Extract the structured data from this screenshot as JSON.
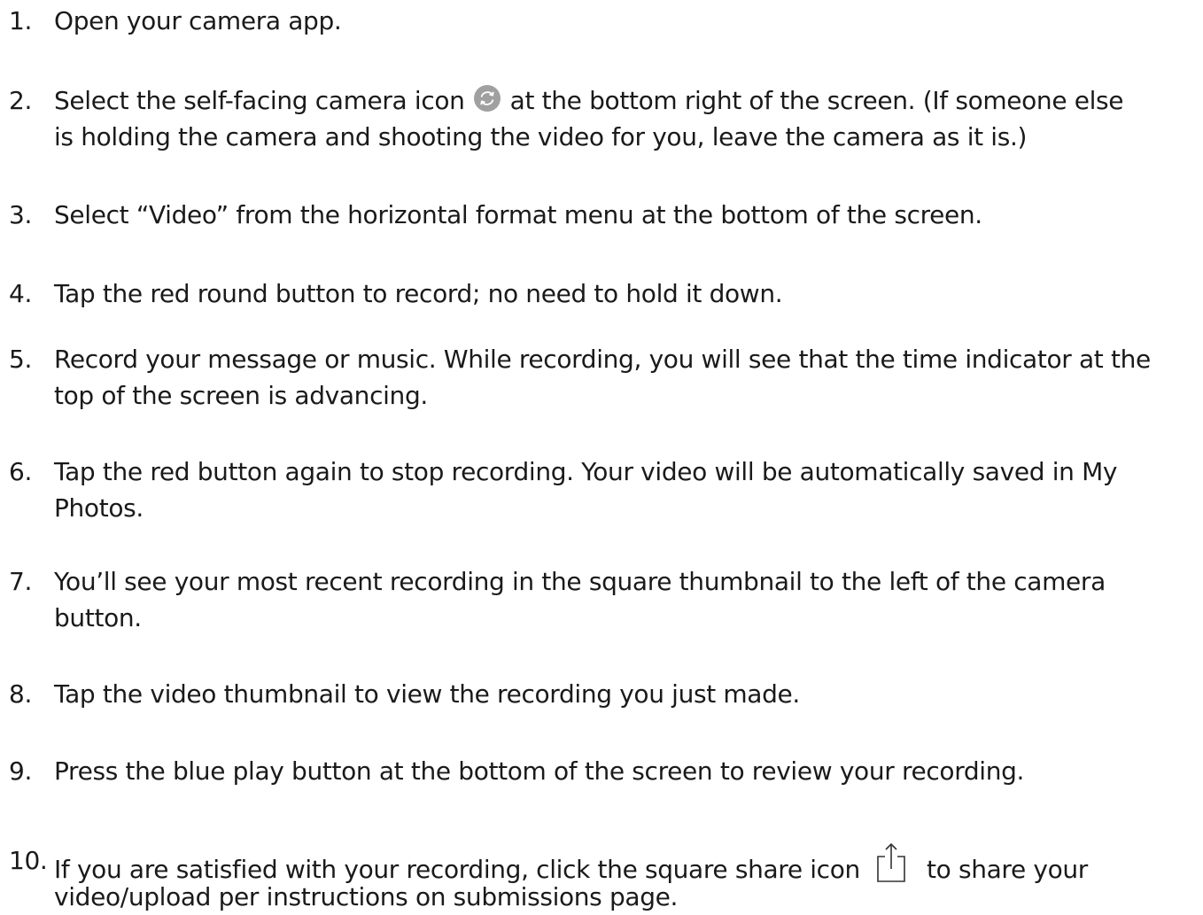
{
  "steps": [
    {
      "num": "1.",
      "line1": "Open your camera app."
    },
    {
      "num": "2.",
      "line1a": "Select the self-facing camera icon",
      "icon": "camera-switch-icon",
      "line1b": "at the bottom right of the screen. (If someone else",
      "line2": "is holding the camera and shooting the video for you, leave the camera as it is.)"
    },
    {
      "num": "3.",
      "line1": "Select “Video” from the horizontal format menu at the bottom of the screen."
    },
    {
      "num": "4.",
      "line1": "Tap the red round button to record; no need to hold it down."
    },
    {
      "num": "5.",
      "line1": "Record your message or music. While recording, you will see that the time indicator at the",
      "line2": "top of the screen is advancing."
    },
    {
      "num": "6.",
      "line1": "Tap the red button again to stop recording. Your video will be automatically saved in My",
      "line2": "Photos."
    },
    {
      "num": "7.",
      "line1": "You’ll see your most recent recording in the square thumbnail to the left of the camera",
      "line2": "button."
    },
    {
      "num": "8.",
      "line1": "Tap the video thumbnail to view the recording you just made."
    },
    {
      "num": "9.",
      "line1": "Press the blue play button at the bottom of the screen to review your recording."
    },
    {
      "num": "10.",
      "line1a": "If you are satisfied with your recording, click the square share icon",
      "icon": "share-icon",
      "line1b": "to share your",
      "line2": "video/upload per instructions on submissions page."
    }
  ],
  "colors": {
    "text": "#1a1a1a",
    "icon_gray": "#9a9a9a"
  }
}
